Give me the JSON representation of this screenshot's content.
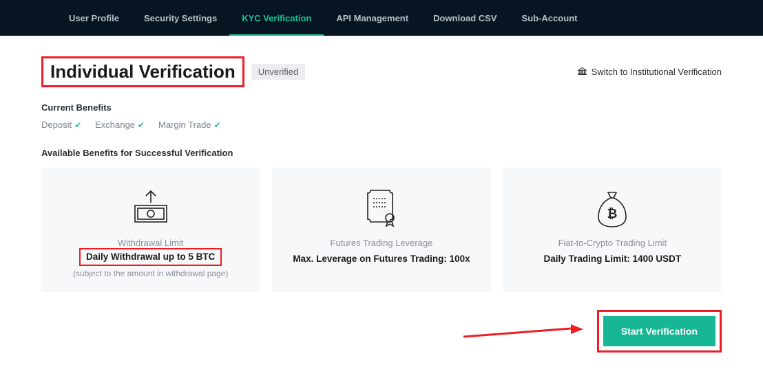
{
  "nav": {
    "items": [
      {
        "label": "User Profile"
      },
      {
        "label": "Security Settings"
      },
      {
        "label": "KYC Verification"
      },
      {
        "label": "API Management"
      },
      {
        "label": "Download CSV"
      },
      {
        "label": "Sub-Account"
      }
    ],
    "active_index": 2
  },
  "title": {
    "text": "Individual Verification",
    "badge": "Unverified",
    "switch_label": "Switch to Institutional Verification"
  },
  "current_benefits": {
    "section_label": "Current Benefits",
    "items": [
      {
        "label": "Deposit"
      },
      {
        "label": "Exchange"
      },
      {
        "label": "Margin Trade"
      }
    ]
  },
  "available_benefits": {
    "section_label": "Available Benefits for Successful Verification",
    "cards": [
      {
        "sub": "Withdrawal Limit",
        "main": "Daily Withdrawal up to 5 BTC",
        "note": "(subject to the amount in withdrawal page)"
      },
      {
        "sub": "Futures Trading Leverage",
        "main": "Max. Leverage on Futures Trading: 100x",
        "note": ""
      },
      {
        "sub": "Fiat-to-Crypto Trading Limit",
        "main": "Daily Trading Limit: 1400 USDT",
        "note": ""
      }
    ]
  },
  "cta": {
    "label": "Start Verification"
  }
}
